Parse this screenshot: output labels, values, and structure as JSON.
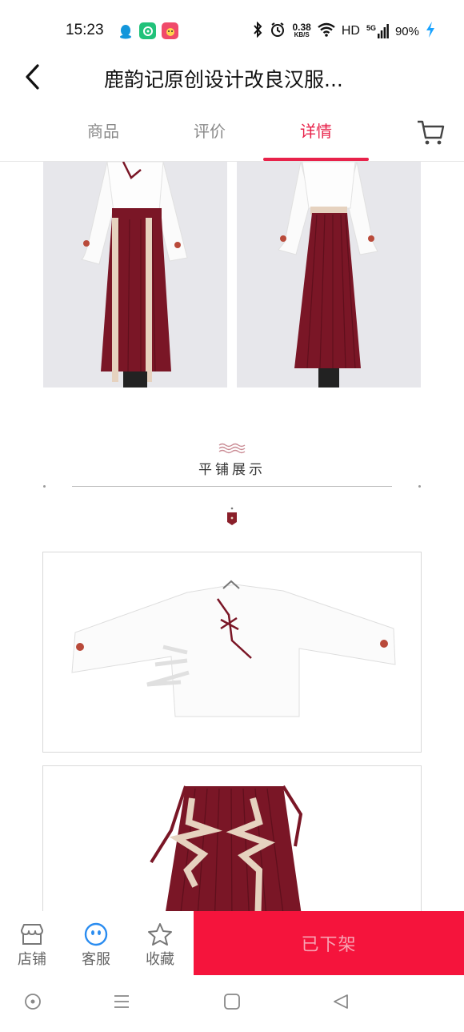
{
  "status_bar": {
    "time": "15:23",
    "net_speed_value": "0.38",
    "net_speed_unit": "KB/S",
    "network_label": "HD",
    "signal_label": "5G",
    "battery": "90%",
    "icons": [
      "qq-icon",
      "wechat-like-icon",
      "game-app-icon",
      "bluetooth-icon",
      "alarm-icon",
      "wifi-icon",
      "signal-icon",
      "charging-icon"
    ]
  },
  "header": {
    "title": "鹿韵记原创设计改良汉服..."
  },
  "tabs": [
    {
      "label": "商品",
      "active": false
    },
    {
      "label": "评价",
      "active": false
    },
    {
      "label": "详情",
      "active": true
    }
  ],
  "content": {
    "section_title": "平铺展示"
  },
  "bottom_bar": {
    "store_label": "店铺",
    "service_label": "客服",
    "favorite_label": "收藏",
    "offshelf_label": "已下架"
  },
  "colors": {
    "accent": "#e8224a",
    "button": "#f5143c",
    "skirt": "#7a1626",
    "ribbon": "#e6d2bf"
  }
}
